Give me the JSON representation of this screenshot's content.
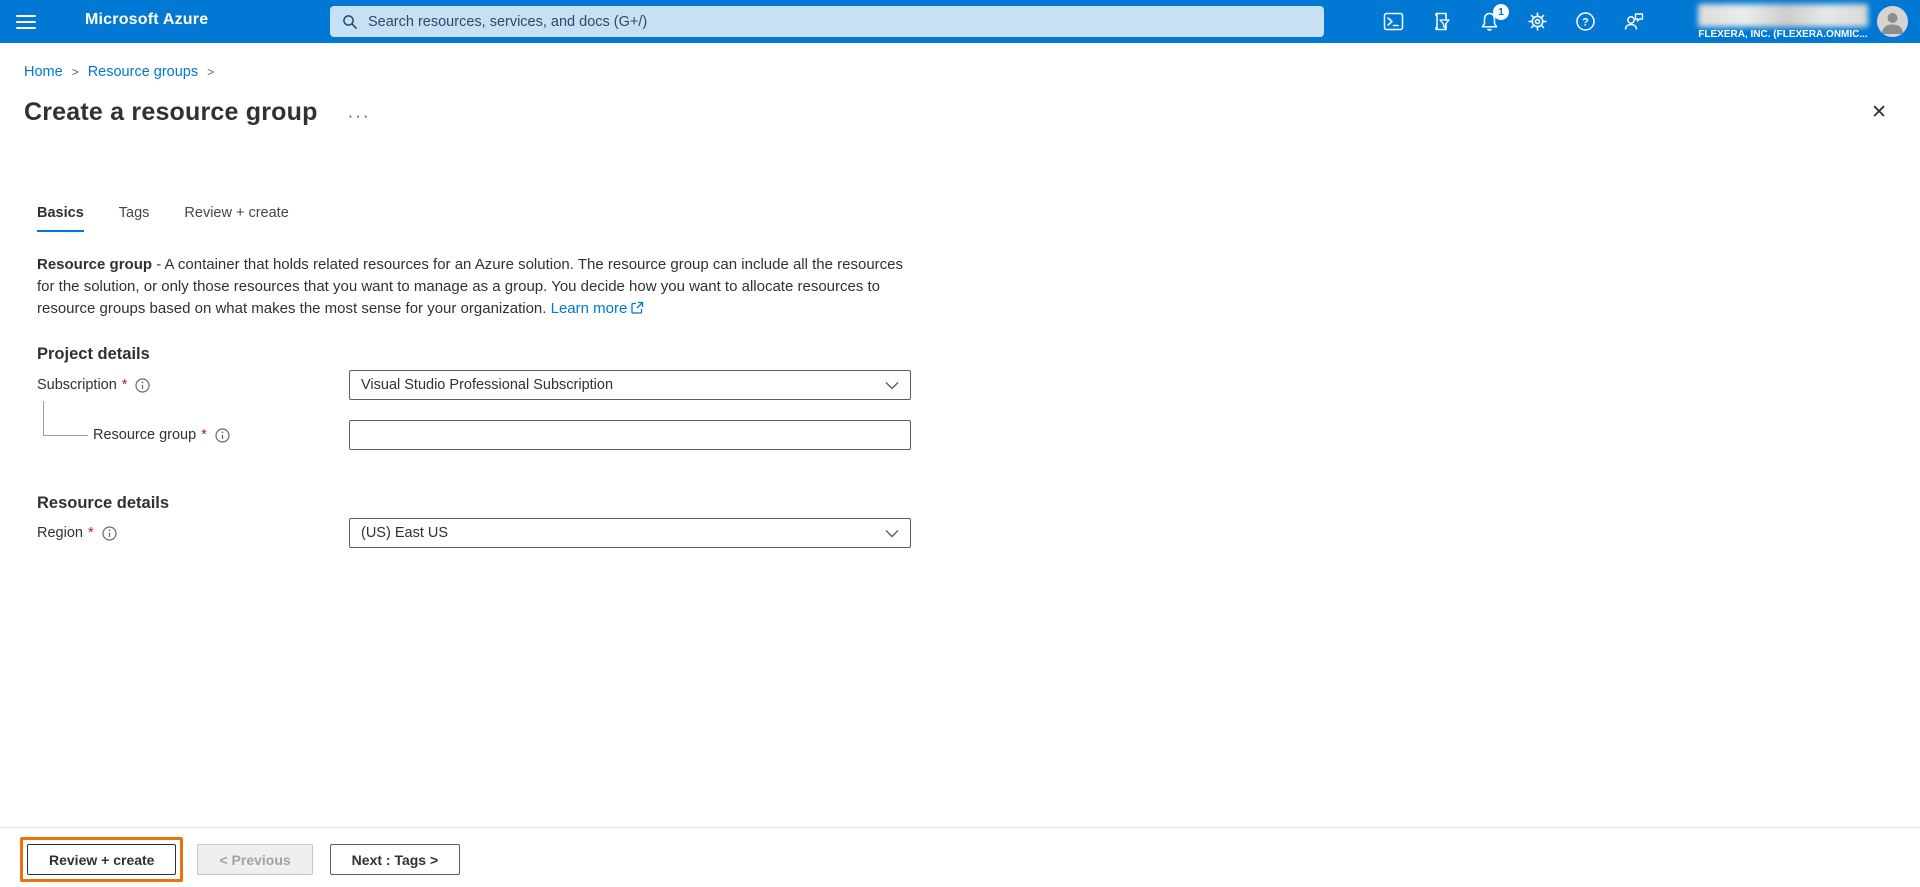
{
  "topbar": {
    "brand": "Microsoft Azure",
    "search_placeholder": "Search resources, services, and docs (G+/)",
    "notification_count": "1",
    "tenant": "FLEXERA, INC. (FLEXERA.ONMIC...",
    "icons": [
      "cloud-shell",
      "directory-filter",
      "notifications",
      "settings",
      "help",
      "feedback"
    ],
    "colors": {
      "bar": "#0078d4",
      "search_bg": "#c7e0f4",
      "accent": "#0078d4"
    }
  },
  "breadcrumb": {
    "items": [
      {
        "label": "Home"
      },
      {
        "label": "Resource groups"
      }
    ],
    "separator": ">"
  },
  "page": {
    "title": "Create a resource group",
    "ellipsis": "···",
    "close": "✕"
  },
  "tabs": [
    {
      "label": "Basics",
      "active": true
    },
    {
      "label": "Tags",
      "active": false
    },
    {
      "label": "Review + create",
      "active": false
    }
  ],
  "description": {
    "lead": "Resource group",
    "text": " - A container that holds related resources for an Azure solution. The resource group can include all the resources for the solution, or only those resources that you want to manage as a group. You decide how you want to allocate resources to resource groups based on what makes the most sense for your organization. ",
    "link": "Learn more"
  },
  "sections": {
    "project": {
      "heading": "Project details",
      "subscription": {
        "label": "Subscription",
        "required": "*",
        "value": "Visual Studio Professional Subscription"
      },
      "resource_group": {
        "label": "Resource group",
        "required": "*",
        "value": "",
        "placeholder": ""
      }
    },
    "resource": {
      "heading": "Resource details",
      "region": {
        "label": "Region",
        "required": "*",
        "value": "(US) East US"
      }
    }
  },
  "footer": {
    "review_create": "Review + create",
    "previous": "< Previous",
    "next": "Next : Tags >",
    "highlight_color": "#ee720b"
  }
}
